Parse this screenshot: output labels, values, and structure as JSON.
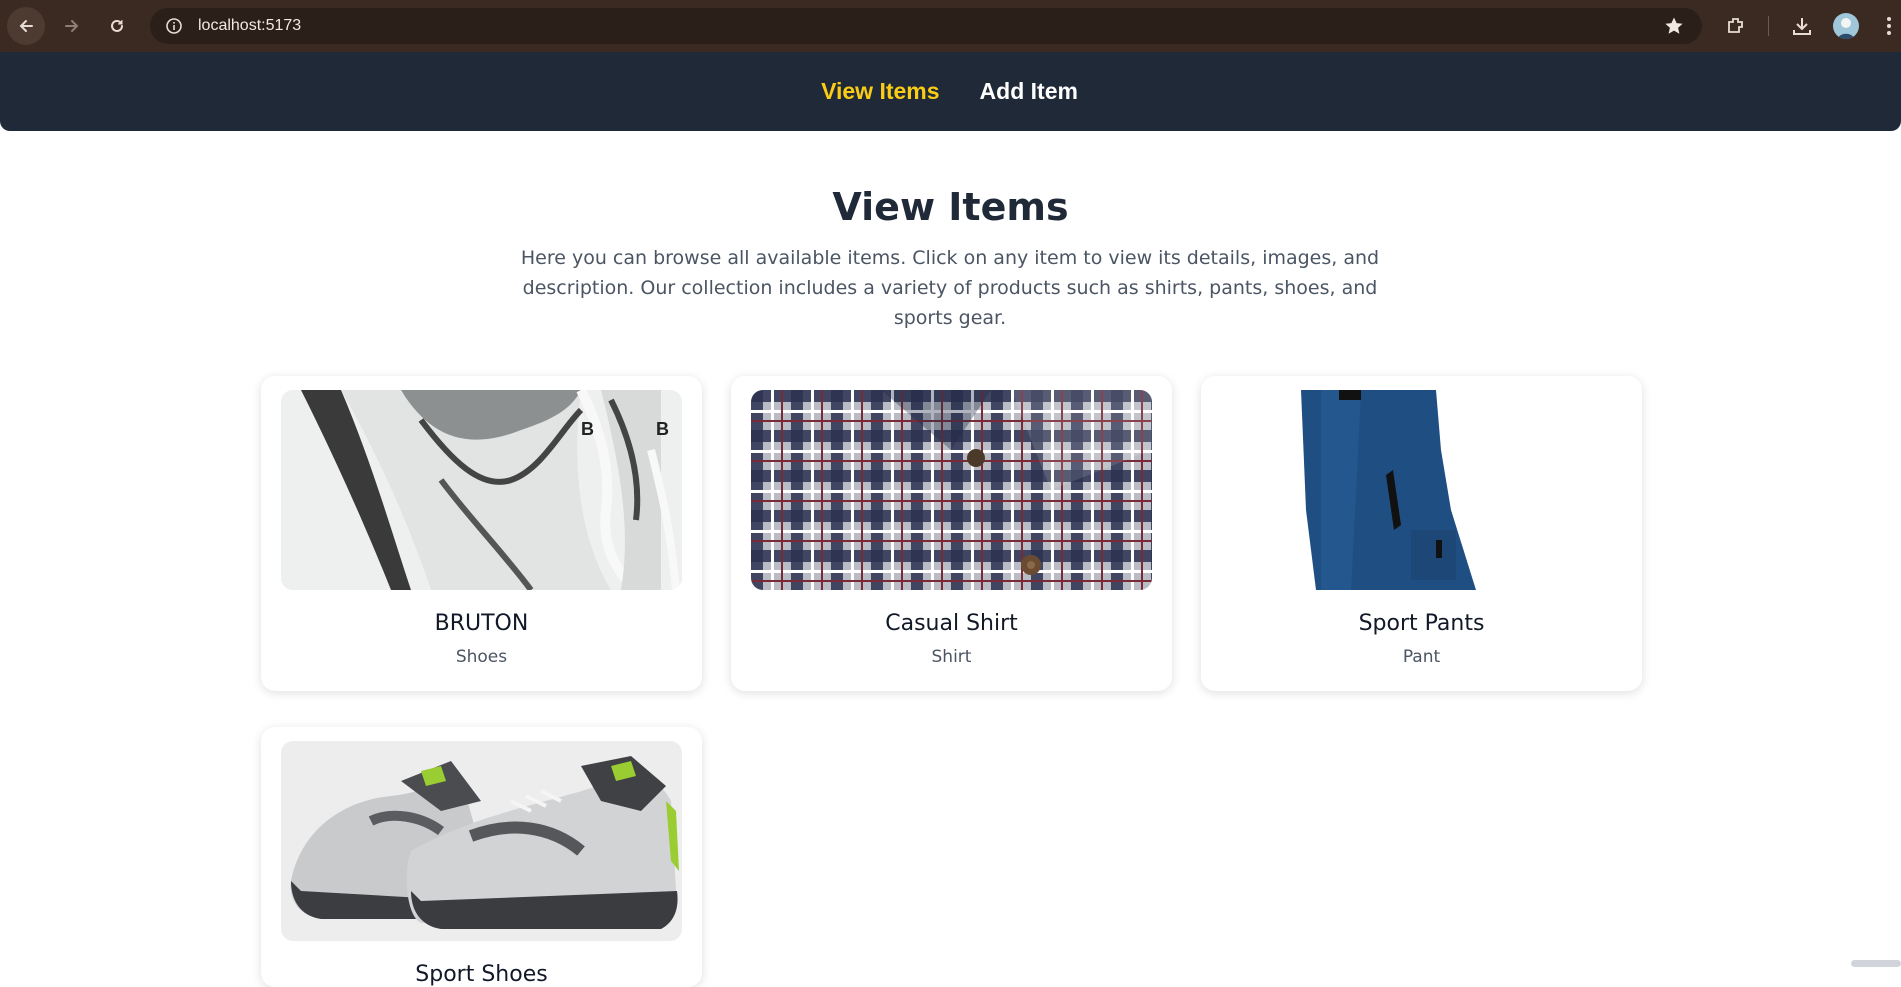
{
  "browser": {
    "url": "localhost:5173"
  },
  "nav": {
    "links": [
      {
        "label": "View Items",
        "active": true
      },
      {
        "label": "Add Item",
        "active": false
      }
    ],
    "active_color": "#facc15",
    "bg_color": "#1f2937"
  },
  "page": {
    "title": "View Items",
    "intro": "Here you can browse all available items. Click on any item to view its details, images, and description. Our collection includes a variety of products such as shirts, pants, shoes, and sports gear."
  },
  "items": [
    {
      "name": "BRUTON",
      "category": "Shoes",
      "image": "white-shoes-closeup"
    },
    {
      "name": "Casual Shirt",
      "category": "Shirt",
      "image": "plaid-shirt"
    },
    {
      "name": "Sport Pants",
      "category": "Pant",
      "image": "blue-pants"
    },
    {
      "name": "Sport Shoes",
      "category": "",
      "image": "grey-sneakers"
    }
  ]
}
